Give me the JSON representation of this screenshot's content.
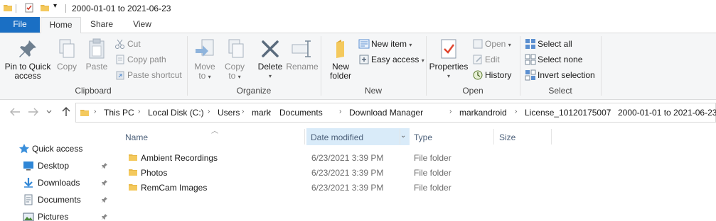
{
  "window": {
    "title": "2000-01-01 to 2021-06-23"
  },
  "tabs": {
    "file": "File",
    "home": "Home",
    "share": "Share",
    "view": "View"
  },
  "ribbon": {
    "clipboard": {
      "label": "Clipboard",
      "pin_line1": "Pin to Quick",
      "pin_line2": "access",
      "copy": "Copy",
      "paste": "Paste",
      "cut": "Cut",
      "copy_path": "Copy path",
      "paste_shortcut": "Paste shortcut"
    },
    "organize": {
      "label": "Organize",
      "move_line1": "Move",
      "move_line2": "to",
      "copy_line1": "Copy",
      "copy_line2": "to",
      "delete": "Delete",
      "rename": "Rename"
    },
    "new": {
      "label": "New",
      "folder_line1": "New",
      "folder_line2": "folder",
      "new_item": "New item",
      "easy_access": "Easy access"
    },
    "open": {
      "label": "Open",
      "properties": "Properties",
      "open": "Open",
      "edit": "Edit",
      "history": "History"
    },
    "select": {
      "label": "Select",
      "select_all": "Select all",
      "select_none": "Select none",
      "invert": "Invert selection"
    }
  },
  "breadcrumb": [
    "This PC",
    "Local Disk (C:)",
    "Users",
    "mark",
    "Documents",
    "Download Manager",
    "markandroid",
    "License_10120175007",
    "2000-01-01 to 2021-06-23"
  ],
  "navpane": {
    "quick_access": "Quick access",
    "items": [
      "Desktop",
      "Downloads",
      "Documents",
      "Pictures"
    ]
  },
  "columns": {
    "name": "Name",
    "date": "Date modified",
    "type": "Type",
    "size": "Size"
  },
  "files": [
    {
      "name": "Ambient Recordings",
      "date": "6/23/2021 3:39 PM",
      "type": "File folder"
    },
    {
      "name": "Photos",
      "date": "6/23/2021 3:39 PM",
      "type": "File folder"
    },
    {
      "name": "RemCam Images",
      "date": "6/23/2021 3:39 PM",
      "type": "File folder"
    }
  ],
  "colors": {
    "accent": "#1a6fc4",
    "folder": "#e8b94a",
    "sort_highlight": "#d9ebf9"
  }
}
